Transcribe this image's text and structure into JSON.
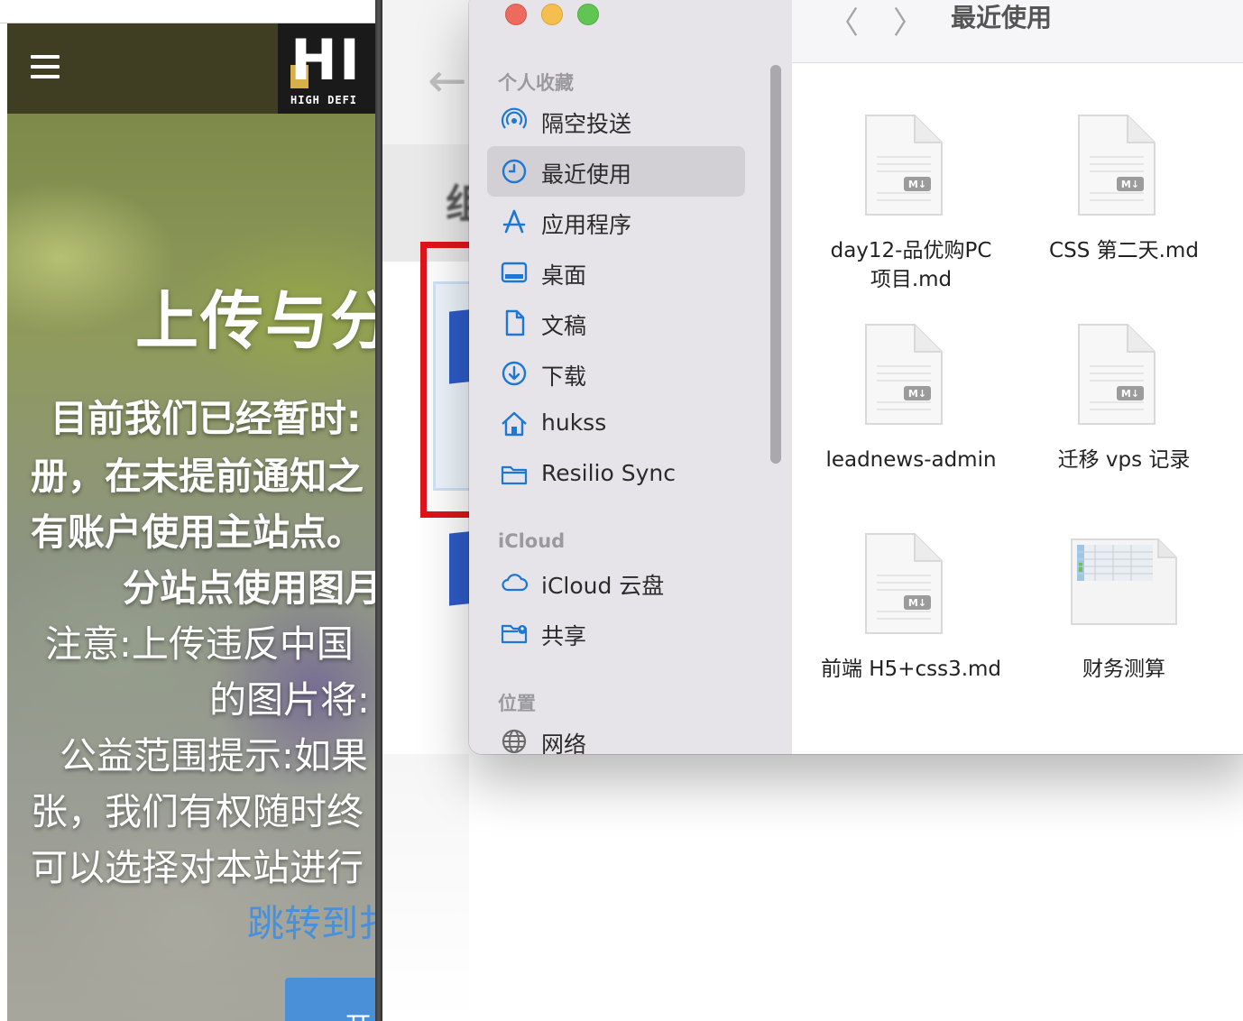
{
  "browser_page": {
    "header": {
      "logo_big": "HI",
      "logo_small": "HIGH DEFI"
    },
    "hero_title": "上传与分",
    "lines": [
      "目前我们已经暂时:",
      "册，在未提前通知之",
      "有账户使用主站点。",
      "分站点使用图月",
      "注意:上传违反中国",
      "的图片将:",
      "公益范围提示:如果",
      "张，我们有权随时终",
      "可以选择对本站进行"
    ],
    "link_text": "跳转到扌",
    "cta_label": "开"
  },
  "background_app": {
    "back_arrow": "←",
    "blurred_text": "组"
  },
  "finder": {
    "window_title": "最近使用",
    "nav_back": "〈",
    "nav_forward": "〉",
    "sidebar": {
      "favorites_header": "个人收藏",
      "favorites": [
        {
          "label": "隔空投送",
          "icon": "airdrop-icon"
        },
        {
          "label": "最近使用",
          "icon": "clock-icon",
          "selected": true
        },
        {
          "label": "应用程序",
          "icon": "applications-icon"
        },
        {
          "label": "桌面",
          "icon": "desktop-icon"
        },
        {
          "label": "文稿",
          "icon": "document-icon"
        },
        {
          "label": "下载",
          "icon": "download-icon"
        },
        {
          "label": "hukss",
          "icon": "home-icon"
        },
        {
          "label": "Resilio Sync",
          "icon": "folder-icon"
        }
      ],
      "icloud_header": "iCloud",
      "icloud": [
        {
          "label": "iCloud 云盘",
          "icon": "cloud-icon"
        },
        {
          "label": "共享",
          "icon": "shared-folder-icon"
        }
      ],
      "locations_header": "位置",
      "locations": [
        {
          "label": "网络",
          "icon": "network-globe-icon"
        }
      ]
    },
    "files": [
      {
        "name_line1": "day12-品优购PC",
        "name_line2": "项目.md",
        "type": "markdown"
      },
      {
        "name_line1": "CSS 第二天.md",
        "name_line2": "",
        "type": "markdown"
      },
      {
        "name_line1": "leadnews-admin",
        "name_line2": "",
        "type": "markdown"
      },
      {
        "name_line1": "迁移 vps 记录",
        "name_line2": "",
        "type": "markdown"
      },
      {
        "name_line1": "前端 H5+css3.md",
        "name_line2": "",
        "type": "markdown"
      },
      {
        "name_line1": "财务测算",
        "name_line2": "",
        "type": "spreadsheet"
      }
    ],
    "markdown_badge": "M↓"
  },
  "colors": {
    "selection_red": "#e0141c",
    "accent_blue": "#1c78d4",
    "link_blue": "#4a90d8"
  }
}
